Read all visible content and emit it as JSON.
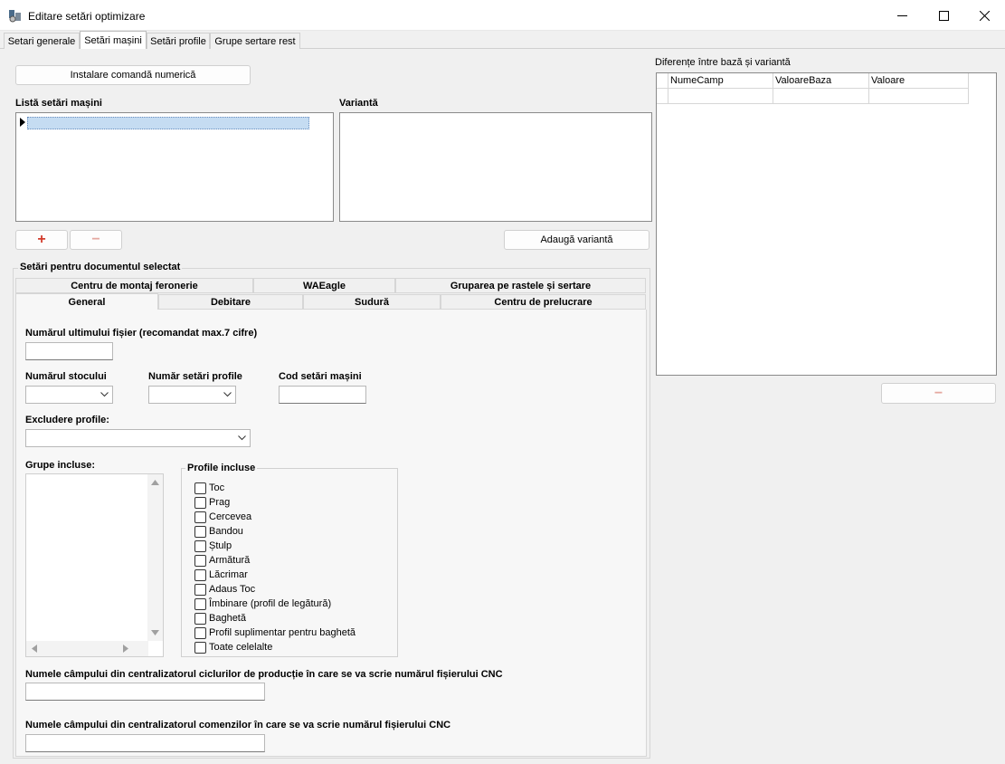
{
  "window": {
    "title": "Editare setări optimizare",
    "minimize": "—",
    "maximize": "☐",
    "close": "✕"
  },
  "tabs": [
    {
      "label": "Setari generale"
    },
    {
      "label": "Setări mașini"
    },
    {
      "label": "Setări profile"
    },
    {
      "label": "Grupe sertare rest"
    }
  ],
  "machine": {
    "install_button": "Instalare comandă numerică",
    "list_label": "Listă setări mașini",
    "variant_label": "Variantă",
    "add_symbol": "+",
    "remove_symbol": "−",
    "add_variant_button": "Adaugă variantă"
  },
  "doc_settings": {
    "group_label": "Setări pentru documentul selectat",
    "tabs_row1": [
      "Centru de montaj feronerie",
      "WAEagle",
      "Gruparea pe rastele și sertare"
    ],
    "tabs_row2": [
      "General",
      "Debitare",
      "Sudură",
      "Centru de prelucrare"
    ],
    "last_file_label": "Numărul ultimului fișier (recomandat max.7 cifre)",
    "last_file_value": "",
    "stock_label": "Numărul stocului",
    "profile_settings_label": "Număr setări profile",
    "machine_code_label": "Cod setări mașini",
    "exclude_label": "Excludere profile:",
    "groups_label": "Grupe incluse:",
    "profiles_group_label": "Profile incluse",
    "profiles": [
      "Toc",
      "Prag",
      "Cercevea",
      "Bandou",
      "Ștulp",
      "Armătură",
      "Lăcrimar",
      "Adaus Toc",
      "Îmbinare (profil de legătură)",
      "Baghetă",
      "Profil suplimentar pentru baghetă",
      "Toate celelalte"
    ],
    "cycles_field_label": "Numele câmpului din centralizatorul ciclurilor de producție în care se va scrie numărul fișierului CNC",
    "orders_field_label": "Numele câmpului din centralizatorul comenzilor în care se va scrie numărul fișierului CNC"
  },
  "differences": {
    "label": "Diferențe între bază și variantă",
    "columns": [
      "NumeCamp",
      "ValoareBaza",
      "Valoare"
    ],
    "remove_symbol": "−"
  }
}
